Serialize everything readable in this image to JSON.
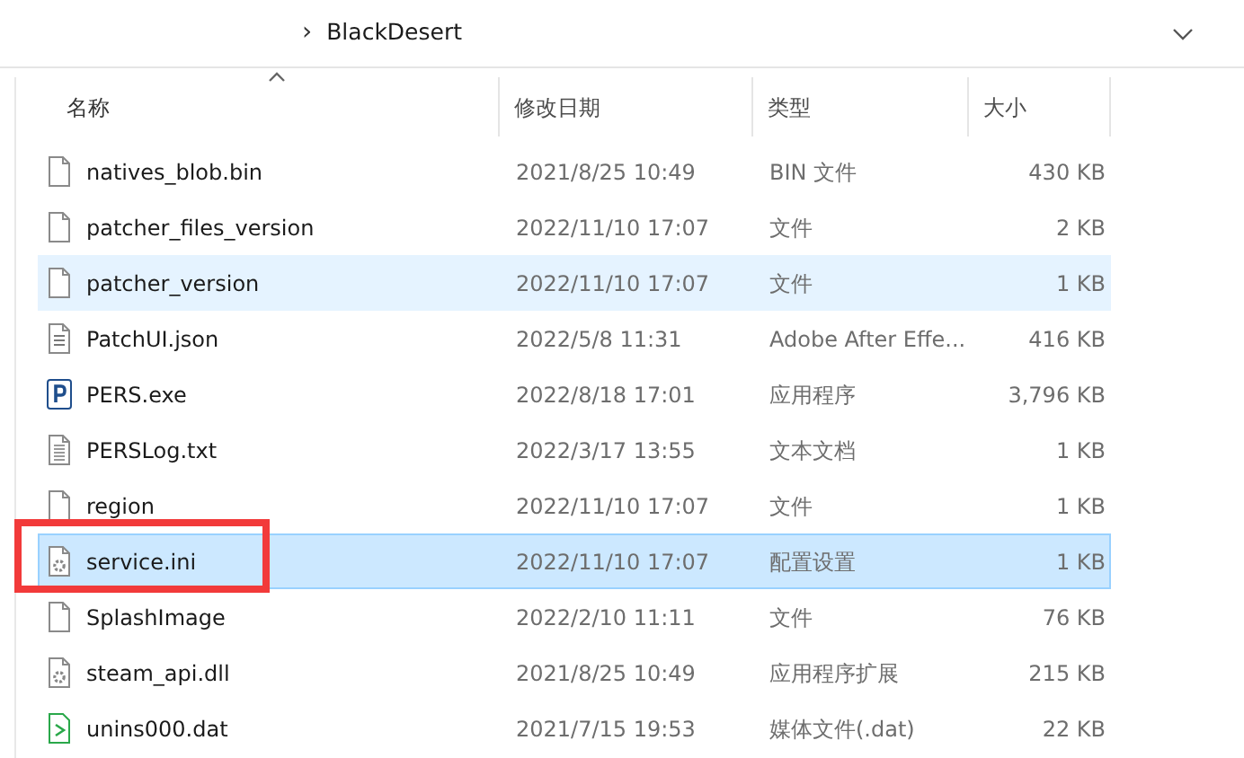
{
  "address_bar": {
    "separator": "›",
    "folder": "BlackDesert"
  },
  "columns": [
    {
      "label": "名称",
      "sorted": true
    },
    {
      "label": "修改日期",
      "sorted": false
    },
    {
      "label": "类型",
      "sorted": false
    },
    {
      "label": "大小",
      "sorted": false
    }
  ],
  "rows": [
    {
      "kind": "blank",
      "name": "natives_blob.bin",
      "modified": "2021/8/25 10:49",
      "type": "BIN 文件",
      "size": "430 KB",
      "hovered": false,
      "selected": false,
      "highlighted": false
    },
    {
      "kind": "blank",
      "name": "patcher_files_version",
      "modified": "2022/11/10 17:07",
      "type": "文件",
      "size": "2 KB",
      "hovered": false,
      "selected": false,
      "highlighted": false
    },
    {
      "kind": "blank",
      "name": "patcher_version",
      "modified": "2022/11/10 17:07",
      "type": "文件",
      "size": "1 KB",
      "hovered": true,
      "selected": false,
      "highlighted": false
    },
    {
      "kind": "list",
      "name": "PatchUI.json",
      "modified": "2022/5/8 11:31",
      "type": "Adobe After Effe...",
      "size": "416 KB",
      "hovered": false,
      "selected": false,
      "highlighted": false
    },
    {
      "kind": "exe",
      "name": "PERS.exe",
      "modified": "2022/8/18 17:01",
      "type": "应用程序",
      "size": "3,796 KB",
      "hovered": false,
      "selected": false,
      "highlighted": false
    },
    {
      "kind": "text",
      "name": "PERSLog.txt",
      "modified": "2022/3/17 13:55",
      "type": "文本文档",
      "size": "1 KB",
      "hovered": false,
      "selected": false,
      "highlighted": false
    },
    {
      "kind": "blank",
      "name": "region",
      "modified": "2022/11/10 17:07",
      "type": "文件",
      "size": "1 KB",
      "hovered": false,
      "selected": false,
      "highlighted": false
    },
    {
      "kind": "gear",
      "name": "service.ini",
      "modified": "2022/11/10 17:07",
      "type": "配置设置",
      "size": "1 KB",
      "hovered": false,
      "selected": true,
      "highlighted": true
    },
    {
      "kind": "blank",
      "name": "SplashImage",
      "modified": "2022/2/10 11:11",
      "type": "文件",
      "size": "76 KB",
      "hovered": false,
      "selected": false,
      "highlighted": false
    },
    {
      "kind": "gear",
      "name": "steam_api.dll",
      "modified": "2021/8/25 10:49",
      "type": "应用程序扩展",
      "size": "215 KB",
      "hovered": false,
      "selected": false,
      "highlighted": false
    },
    {
      "kind": "media",
      "name": "unins000.dat",
      "modified": "2021/7/15 19:53",
      "type": "媒体文件(.dat)",
      "size": "22 KB",
      "hovered": false,
      "selected": false,
      "highlighted": false
    }
  ]
}
